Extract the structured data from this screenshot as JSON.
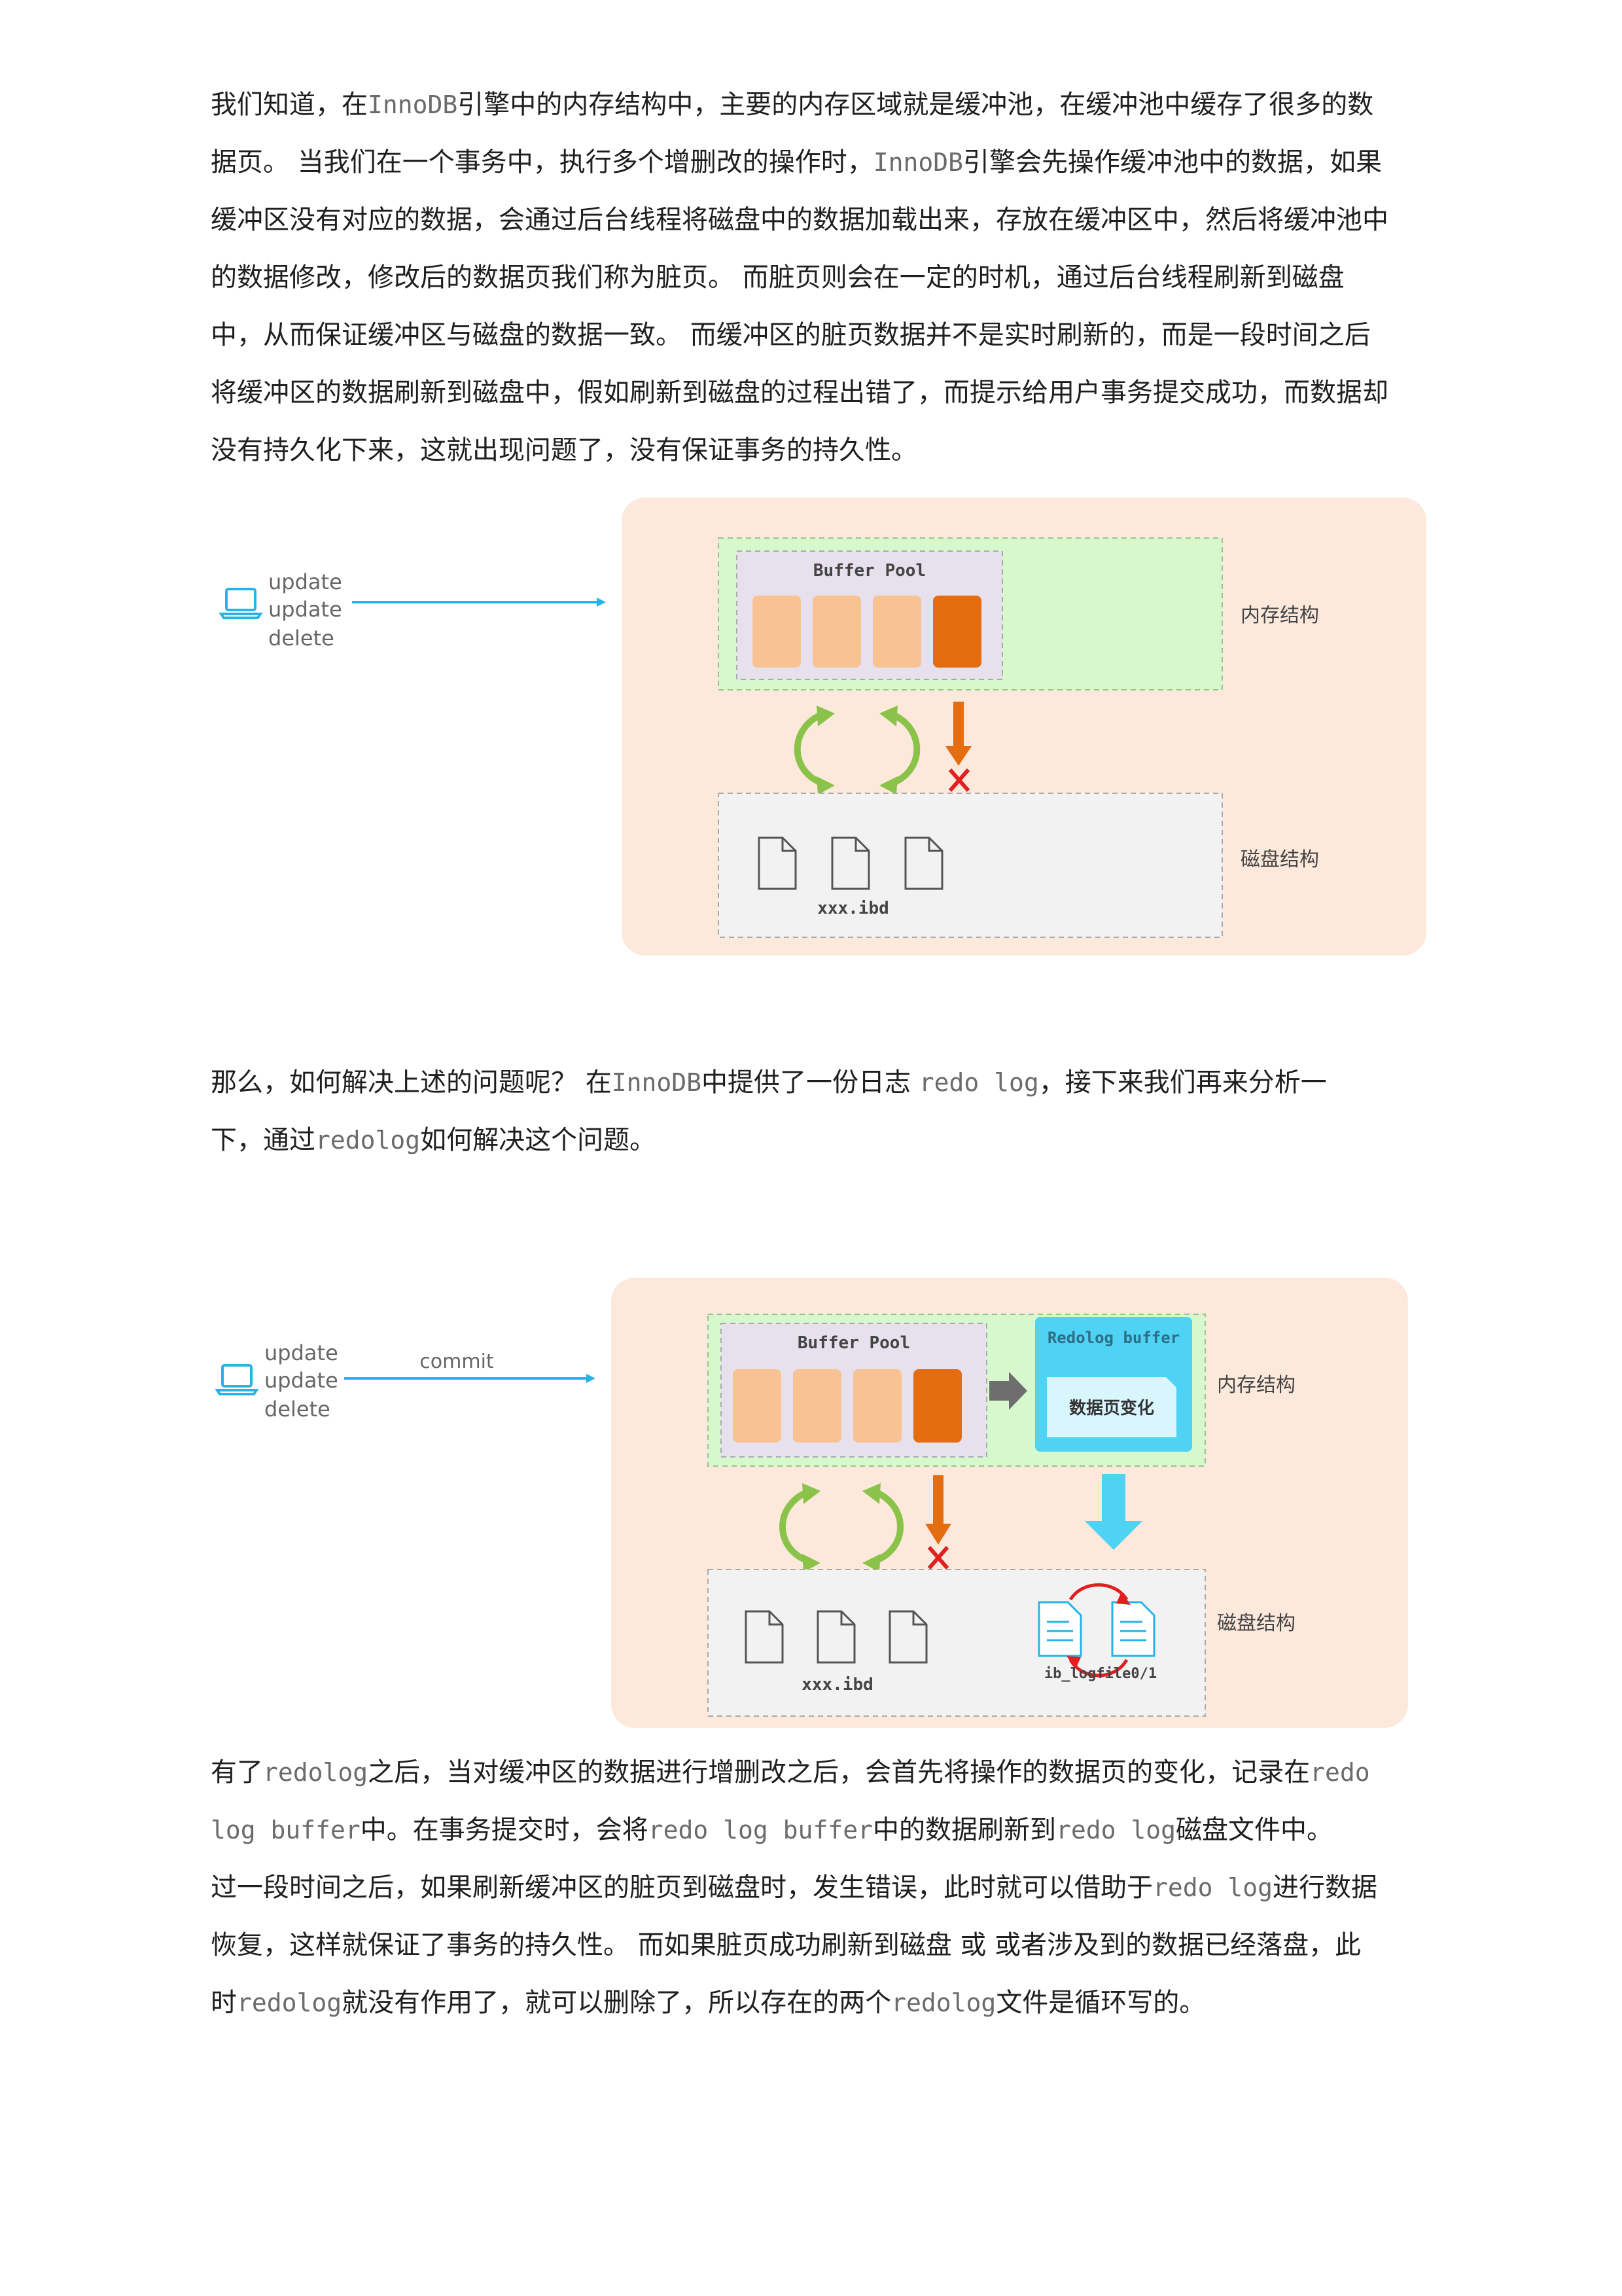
{
  "para1": {
    "lines": [
      [
        {
          "t": "我们知道，在"
        },
        {
          "t": "InnoDB",
          "code": true
        },
        {
          "t": "引擎中的内存结构中，主要的内存区域就是缓冲池，在缓冲池中缓存了很多的数"
        }
      ],
      [
        {
          "t": "据页。 当我们在一个事务中，执行多个增删改的操作时，"
        },
        {
          "t": "InnoDB",
          "code": true
        },
        {
          "t": "引擎会先操作缓冲池中的数据，如果"
        }
      ],
      [
        {
          "t": "缓冲区没有对应的数据，会通过后台线程将磁盘中的数据加载出来，存放在缓冲区中，然后将缓冲池中"
        }
      ],
      [
        {
          "t": "的数据修改，修改后的数据页我们称为脏页。 而脏页则会在一定的时机，通过后台线程刷新到磁盘"
        }
      ],
      [
        {
          "t": "中，从而保证缓冲区与磁盘的数据一致。 而缓冲区的脏页数据并不是实时刷新的，而是一段时间之后"
        }
      ],
      [
        {
          "t": "将缓冲区的数据刷新到磁盘中，假如刷新到磁盘的过程出错了，而提示给用户事务提交成功，而数据却"
        }
      ],
      [
        {
          "t": "没有持久化下来，这就出现问题了，没有保证事务的持久性。"
        }
      ]
    ]
  },
  "diagram1": {
    "ops": [
      "update",
      "update",
      "delete"
    ],
    "buffer_pool_label": "Buffer Pool",
    "memory_label": "内存结构",
    "disk_label": "磁盘结构",
    "file_label": "xxx.ibd",
    "colors": {
      "bg": "#fde9dc",
      "memory": "#d7f7cd",
      "disk": "#f2f2f2",
      "pool": "#e6e1ec",
      "page": "#f8c292",
      "page_dirty": "#e46d12",
      "arrow": "#27b2e8",
      "green": "#8bc34a",
      "red_x": "#e02020"
    }
  },
  "para2": {
    "lines": [
      [
        {
          "t": "那么，如何解决上述的问题呢？ 在"
        },
        {
          "t": "InnoDB",
          "code": true
        },
        {
          "t": "中提供了一份日志 "
        },
        {
          "t": "redo log",
          "code": true
        },
        {
          "t": "，接下来我们再来分析一"
        }
      ],
      [
        {
          "t": "下，通过"
        },
        {
          "t": "redolog",
          "code": true
        },
        {
          "t": "如何解决这个问题。"
        }
      ]
    ]
  },
  "diagram2": {
    "ops": [
      "update",
      "update",
      "delete"
    ],
    "commit_label": "commit",
    "buffer_pool_label": "Buffer Pool",
    "redolog_buffer_label": "Redolog buffer",
    "page_change_label": "数据页变化",
    "memory_label": "内存结构",
    "disk_label": "磁盘结构",
    "file_label": "xxx.ibd",
    "logfile_label": "ib_logfile0/1"
  },
  "para3": {
    "lines": [
      [
        {
          "t": "有了"
        },
        {
          "t": "redolog",
          "code": true
        },
        {
          "t": "之后，当对缓冲区的数据进行增删改之后，会首先将操作的数据页的变化，记录在"
        },
        {
          "t": "redo",
          "code": true
        }
      ],
      [
        {
          "t": "log buffer",
          "code": true
        },
        {
          "t": "中。在事务提交时，会将"
        },
        {
          "t": "redo log buffer",
          "code": true
        },
        {
          "t": "中的数据刷新到"
        },
        {
          "t": "redo log",
          "code": true
        },
        {
          "t": "磁盘文件中。"
        }
      ],
      [
        {
          "t": "过一段时间之后，如果刷新缓冲区的脏页到磁盘时，发生错误，此时就可以借助于"
        },
        {
          "t": "redo log",
          "code": true
        },
        {
          "t": "进行数据"
        }
      ],
      [
        {
          "t": "恢复，这样就保证了事务的持久性。 而如果脏页成功刷新到磁盘 或 或者涉及到的数据已经落盘，此"
        }
      ],
      [
        {
          "t": "时"
        },
        {
          "t": "redolog",
          "code": true
        },
        {
          "t": "就没有作用了，就可以删除了，所以存在的两个"
        },
        {
          "t": "redolog",
          "code": true
        },
        {
          "t": "文件是循环写的。"
        }
      ]
    ]
  }
}
